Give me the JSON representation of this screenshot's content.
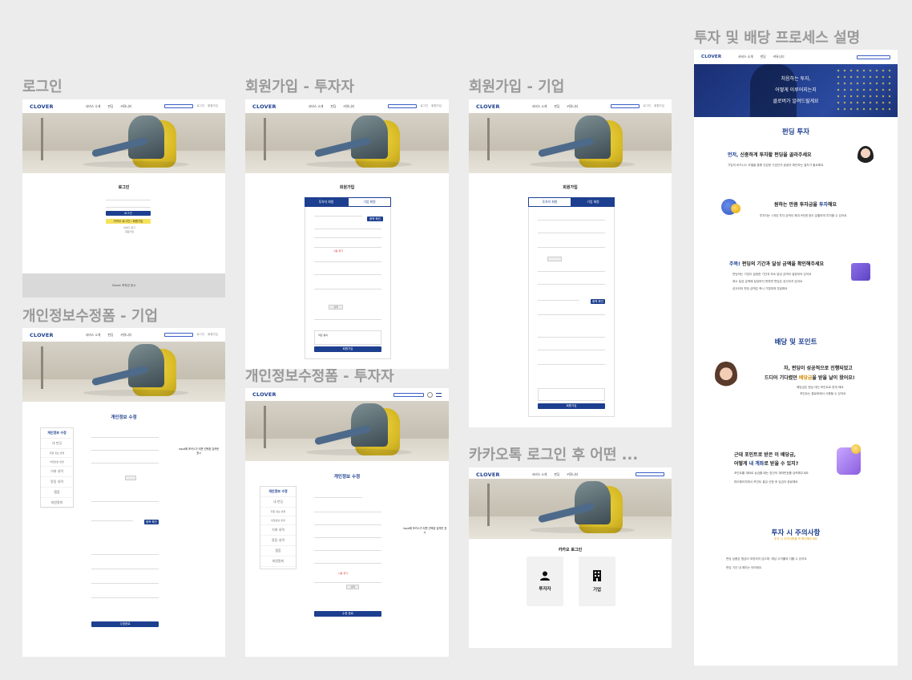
{
  "brand": {
    "logo": "CLOVER",
    "accent": "#1d3f8f",
    "yellow": "#f6e25b"
  },
  "nav": {
    "links": [
      "서비스 소개",
      "펀딩",
      "커뮤니티"
    ],
    "login": "로그인",
    "signup": "회원가입"
  },
  "frames": {
    "login": {
      "title": "로그인",
      "heading": "로그인",
      "login_button": "로그인",
      "kakao_button": "카카오 로그인 / 회원가입",
      "links": [
        "아이디 찾기",
        "회원가입"
      ],
      "footer": "Clover 저작권 표시"
    },
    "signup_investor": {
      "title": "회원가입 - 투자자",
      "heading": "회원가입",
      "tabs": [
        "투자자 회원",
        "기업 회원"
      ],
      "check_button": "중복 확인",
      "find_button": "검색",
      "error_text": "사용 불가",
      "terms_title": "약관 동의",
      "submit": "회원가입"
    },
    "signup_company": {
      "title": "회원가입 - 기업",
      "heading": "회원가입",
      "tabs": [
        "투자자 회원",
        "기업 회원"
      ],
      "check_button": "중복 확인",
      "submit": "회원가입"
    },
    "edit_company": {
      "title": "개인정보수정폼 - 기업",
      "heading": "개인정보 수정",
      "sidebar": [
        "개인정보 수정",
        "내 펀딩",
        "회원 정보 변경",
        "비밀번호 변경",
        "거래 내역",
        "알림 내역",
        "찜함",
        "회원탈퇴"
      ],
      "note": "input에 포커스가 되면 선택된 입력란 표시",
      "submit": "수정완료"
    },
    "edit_investor": {
      "title": "개인정보수정폼 - 투자자",
      "heading": "개인정보 수정",
      "sidebar": [
        "개인정보 수정",
        "내 펀딩",
        "회원 정보 변경",
        "비밀번호 변경",
        "거래 내역",
        "알림 내역",
        "찜함",
        "회원탈퇴"
      ],
      "note": "input에 포커스가 되면 선택된 입력란 표시",
      "submit": "수정 완료"
    },
    "kakao_after": {
      "title": "카카오톡 로그인 후 어떤 ...",
      "heading": "카카오 로그인",
      "cards": [
        {
          "label": "투자자",
          "icon": "person-icon"
        },
        {
          "label": "기업",
          "icon": "building-icon"
        }
      ]
    },
    "process": {
      "title": "투자 및 배당 프로세스 설명",
      "banner": [
        "처음하는 투자,",
        "어떻게 이루어지는지",
        "클로버가 알려드릴게요"
      ],
      "funding_heading": "펀딩 투자",
      "step1": {
        "prefix": "먼저,",
        "text": " 신중하게 투자할 펀딩을 골라주세요",
        "sub": "기업의 비즈니스 모델을 통해 건강한 기업인지 꼼꼼히 확인하는 절차가 필요해요"
      },
      "step2": {
        "text": "원하는 만큼 투자금을 ",
        "hl": "투자",
        "tail": "해요",
        "sub": "투자자는 1개당 투자 금액이 최대 9만원 정도 분할하여 투자할 수 있어요"
      },
      "step3": {
        "prefix": "주목!",
        "text": " 펀딩의 기간과 달성 금액을 확인해주세요",
        "subs": [
          "펀딩하는 기업이 설정한 기간과 최소 달성 금액이 설정되어 있어요",
          "최소 달성 금액에 달성하지 못하면 펀딩은 성사되지 않아요",
          "성사되어 펀딩 금액은 즉시 기업에게 전달돼요"
        ]
      },
      "dividend_heading": "배당 및 포인트",
      "step4": {
        "line1": "자, 펀딩이 성공적으로 진행되었고",
        "line2a": "드디어 기다렸던 ",
        "hl": "배당금",
        "line2b": "을 받을 날이 왔어요!",
        "subs": [
          "배당금은 현금 대신 포인트로 받게 돼요",
          "포인트는 클로버에서 사용할 수 있어요"
        ]
      },
      "step5": {
        "line1": "근데 포인트로 받은 이 배당금,",
        "line2a": "어떻게 ",
        "hl": "내 계좌",
        "line2b": "로 받을 수 있지?",
        "subs": [
          "포인트를 계좌로 송금할 때는 본인의 계좌번호를 입력해주세요",
          "마이페이지에서 포인트 출금 신청 후 입금이 완료돼요"
        ]
      },
      "caution_heading": "투자 시 주의사항",
      "caution_sub": "투자 시 주의사항을 꼭 확인해주세요",
      "caution_lines": [
        "펀딩 상품은 원금이 보장되지 않으며, 예상 수익률과 다를 수 있어요",
        "펀딩 기간 내 해지는 어려워요"
      ]
    }
  }
}
